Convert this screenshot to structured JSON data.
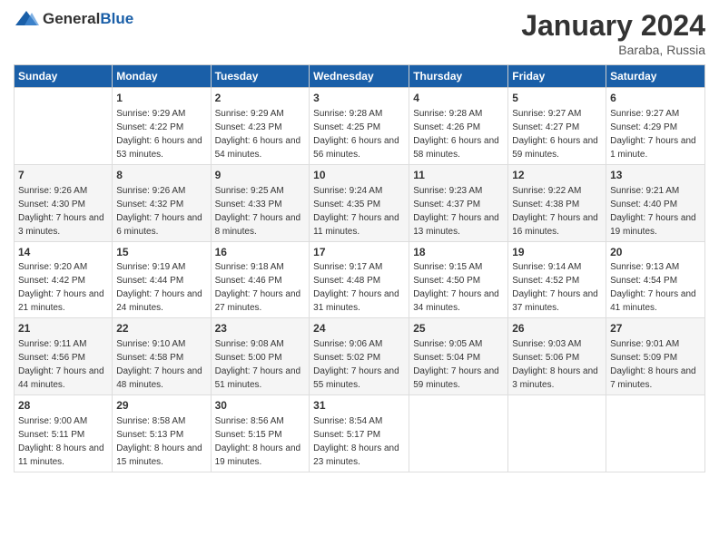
{
  "header": {
    "logo_general": "General",
    "logo_blue": "Blue",
    "month": "January 2024",
    "location": "Baraba, Russia"
  },
  "columns": [
    "Sunday",
    "Monday",
    "Tuesday",
    "Wednesday",
    "Thursday",
    "Friday",
    "Saturday"
  ],
  "weeks": [
    [
      {
        "day": "",
        "sunrise": "",
        "sunset": "",
        "daylight": ""
      },
      {
        "day": "1",
        "sunrise": "Sunrise: 9:29 AM",
        "sunset": "Sunset: 4:22 PM",
        "daylight": "Daylight: 6 hours and 53 minutes."
      },
      {
        "day": "2",
        "sunrise": "Sunrise: 9:29 AM",
        "sunset": "Sunset: 4:23 PM",
        "daylight": "Daylight: 6 hours and 54 minutes."
      },
      {
        "day": "3",
        "sunrise": "Sunrise: 9:28 AM",
        "sunset": "Sunset: 4:25 PM",
        "daylight": "Daylight: 6 hours and 56 minutes."
      },
      {
        "day": "4",
        "sunrise": "Sunrise: 9:28 AM",
        "sunset": "Sunset: 4:26 PM",
        "daylight": "Daylight: 6 hours and 58 minutes."
      },
      {
        "day": "5",
        "sunrise": "Sunrise: 9:27 AM",
        "sunset": "Sunset: 4:27 PM",
        "daylight": "Daylight: 6 hours and 59 minutes."
      },
      {
        "day": "6",
        "sunrise": "Sunrise: 9:27 AM",
        "sunset": "Sunset: 4:29 PM",
        "daylight": "Daylight: 7 hours and 1 minute."
      }
    ],
    [
      {
        "day": "7",
        "sunrise": "Sunrise: 9:26 AM",
        "sunset": "Sunset: 4:30 PM",
        "daylight": "Daylight: 7 hours and 3 minutes."
      },
      {
        "day": "8",
        "sunrise": "Sunrise: 9:26 AM",
        "sunset": "Sunset: 4:32 PM",
        "daylight": "Daylight: 7 hours and 6 minutes."
      },
      {
        "day": "9",
        "sunrise": "Sunrise: 9:25 AM",
        "sunset": "Sunset: 4:33 PM",
        "daylight": "Daylight: 7 hours and 8 minutes."
      },
      {
        "day": "10",
        "sunrise": "Sunrise: 9:24 AM",
        "sunset": "Sunset: 4:35 PM",
        "daylight": "Daylight: 7 hours and 11 minutes."
      },
      {
        "day": "11",
        "sunrise": "Sunrise: 9:23 AM",
        "sunset": "Sunset: 4:37 PM",
        "daylight": "Daylight: 7 hours and 13 minutes."
      },
      {
        "day": "12",
        "sunrise": "Sunrise: 9:22 AM",
        "sunset": "Sunset: 4:38 PM",
        "daylight": "Daylight: 7 hours and 16 minutes."
      },
      {
        "day": "13",
        "sunrise": "Sunrise: 9:21 AM",
        "sunset": "Sunset: 4:40 PM",
        "daylight": "Daylight: 7 hours and 19 minutes."
      }
    ],
    [
      {
        "day": "14",
        "sunrise": "Sunrise: 9:20 AM",
        "sunset": "Sunset: 4:42 PM",
        "daylight": "Daylight: 7 hours and 21 minutes."
      },
      {
        "day": "15",
        "sunrise": "Sunrise: 9:19 AM",
        "sunset": "Sunset: 4:44 PM",
        "daylight": "Daylight: 7 hours and 24 minutes."
      },
      {
        "day": "16",
        "sunrise": "Sunrise: 9:18 AM",
        "sunset": "Sunset: 4:46 PM",
        "daylight": "Daylight: 7 hours and 27 minutes."
      },
      {
        "day": "17",
        "sunrise": "Sunrise: 9:17 AM",
        "sunset": "Sunset: 4:48 PM",
        "daylight": "Daylight: 7 hours and 31 minutes."
      },
      {
        "day": "18",
        "sunrise": "Sunrise: 9:15 AM",
        "sunset": "Sunset: 4:50 PM",
        "daylight": "Daylight: 7 hours and 34 minutes."
      },
      {
        "day": "19",
        "sunrise": "Sunrise: 9:14 AM",
        "sunset": "Sunset: 4:52 PM",
        "daylight": "Daylight: 7 hours and 37 minutes."
      },
      {
        "day": "20",
        "sunrise": "Sunrise: 9:13 AM",
        "sunset": "Sunset: 4:54 PM",
        "daylight": "Daylight: 7 hours and 41 minutes."
      }
    ],
    [
      {
        "day": "21",
        "sunrise": "Sunrise: 9:11 AM",
        "sunset": "Sunset: 4:56 PM",
        "daylight": "Daylight: 7 hours and 44 minutes."
      },
      {
        "day": "22",
        "sunrise": "Sunrise: 9:10 AM",
        "sunset": "Sunset: 4:58 PM",
        "daylight": "Daylight: 7 hours and 48 minutes."
      },
      {
        "day": "23",
        "sunrise": "Sunrise: 9:08 AM",
        "sunset": "Sunset: 5:00 PM",
        "daylight": "Daylight: 7 hours and 51 minutes."
      },
      {
        "day": "24",
        "sunrise": "Sunrise: 9:06 AM",
        "sunset": "Sunset: 5:02 PM",
        "daylight": "Daylight: 7 hours and 55 minutes."
      },
      {
        "day": "25",
        "sunrise": "Sunrise: 9:05 AM",
        "sunset": "Sunset: 5:04 PM",
        "daylight": "Daylight: 7 hours and 59 minutes."
      },
      {
        "day": "26",
        "sunrise": "Sunrise: 9:03 AM",
        "sunset": "Sunset: 5:06 PM",
        "daylight": "Daylight: 8 hours and 3 minutes."
      },
      {
        "day": "27",
        "sunrise": "Sunrise: 9:01 AM",
        "sunset": "Sunset: 5:09 PM",
        "daylight": "Daylight: 8 hours and 7 minutes."
      }
    ],
    [
      {
        "day": "28",
        "sunrise": "Sunrise: 9:00 AM",
        "sunset": "Sunset: 5:11 PM",
        "daylight": "Daylight: 8 hours and 11 minutes."
      },
      {
        "day": "29",
        "sunrise": "Sunrise: 8:58 AM",
        "sunset": "Sunset: 5:13 PM",
        "daylight": "Daylight: 8 hours and 15 minutes."
      },
      {
        "day": "30",
        "sunrise": "Sunrise: 8:56 AM",
        "sunset": "Sunset: 5:15 PM",
        "daylight": "Daylight: 8 hours and 19 minutes."
      },
      {
        "day": "31",
        "sunrise": "Sunrise: 8:54 AM",
        "sunset": "Sunset: 5:17 PM",
        "daylight": "Daylight: 8 hours and 23 minutes."
      },
      {
        "day": "",
        "sunrise": "",
        "sunset": "",
        "daylight": ""
      },
      {
        "day": "",
        "sunrise": "",
        "sunset": "",
        "daylight": ""
      },
      {
        "day": "",
        "sunrise": "",
        "sunset": "",
        "daylight": ""
      }
    ]
  ]
}
